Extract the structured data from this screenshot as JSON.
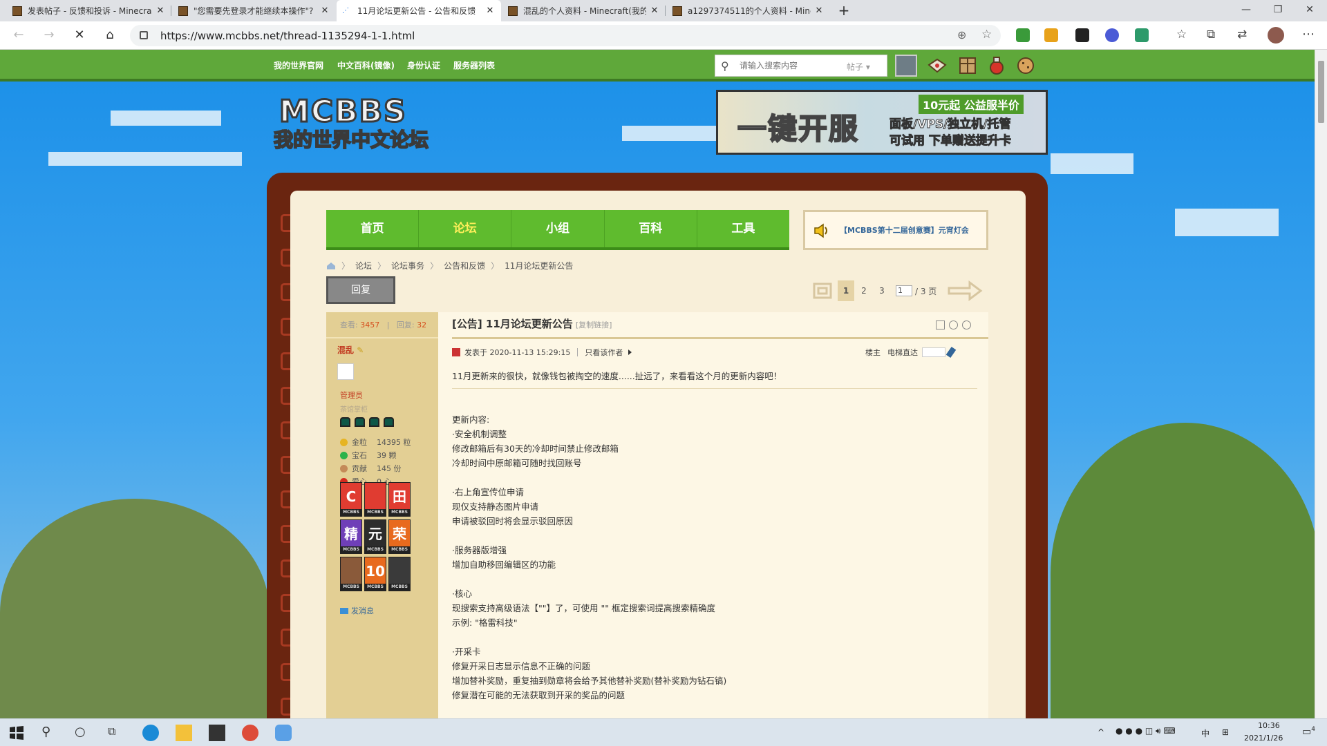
{
  "browser": {
    "tabs": [
      {
        "title": "发表帖子 - 反馈和投诉 - Minecra"
      },
      {
        "title": "\"您需要先登录才能继续本操作\"?"
      },
      {
        "title": "11月论坛更新公告 - 公告和反馈"
      },
      {
        "title": "混乱的个人资料 - Minecraft(我的"
      },
      {
        "title": "a1297374511的个人资料 - Mine"
      }
    ],
    "url": "https://www.mcbbs.net/thread-1135294-1-1.html"
  },
  "topnav": {
    "links": [
      "我的世界官网",
      "中文百科(镜像)",
      "身份认证",
      "服务器列表"
    ],
    "search_placeholder": "请输入搜索内容",
    "search_type": "帖子"
  },
  "banner": {
    "big": "一键开服",
    "tag": "10元起 公益服半价",
    "line1": "面板/VPS/独立机/托管",
    "line2": "可试用 下单赠送提升卡"
  },
  "mainnav": {
    "items": [
      "首页",
      "论坛",
      "小组",
      "百科",
      "工具"
    ],
    "active_index": 1
  },
  "announcement": "【MCBBS第十二届创意赛】元宵灯会",
  "breadcrumbs": [
    "论坛",
    "论坛事务",
    "公告和反馈",
    "11月论坛更新公告"
  ],
  "reply_button": "回复",
  "pager": {
    "pages": [
      "1",
      "2",
      "3"
    ],
    "current": "1",
    "total": "/ 3 页"
  },
  "sidebar": {
    "views_label": "查看:",
    "views": "3457",
    "replies_label": "回复:",
    "replies": "32",
    "username": "混乱",
    "group": "管理员",
    "title": "茶馆掌柜",
    "stats": [
      {
        "label": "金粒",
        "value": "14395 粒",
        "color": "#e6b422"
      },
      {
        "label": "宝石",
        "value": "39 颗",
        "color": "#2db34a"
      },
      {
        "label": "贡献",
        "value": "145 份",
        "color": "#c48a58"
      },
      {
        "label": "爱心",
        "value": "0 心",
        "color": "#d42a1e"
      }
    ],
    "medals": [
      {
        "glyph": "C",
        "color": "#e03c31"
      },
      {
        "glyph": "",
        "color": "#e03c31"
      },
      {
        "glyph": "田",
        "color": "#e03c31"
      },
      {
        "glyph": "精",
        "color": "#6f3fb8"
      },
      {
        "glyph": "元",
        "color": "#2c2c2c"
      },
      {
        "glyph": "荣",
        "color": "#e86a1e"
      },
      {
        "glyph": "",
        "color": "#8a5a3a"
      },
      {
        "glyph": "10",
        "color": "#e86a1e"
      },
      {
        "glyph": "",
        "color": "#3a3a3a"
      }
    ],
    "medal_caption": "MCBBS",
    "send_message": "发消息"
  },
  "post": {
    "title": "[公告] 11月论坛更新公告",
    "copy_link": "[复制链接]",
    "posted": "发表于 2020-11-13 15:29:15",
    "only_author": "只看该作者",
    "floor": "楼主",
    "jump": "电梯直达",
    "lines": [
      "11月更新来的很快，就像钱包被掏空的速度......扯远了，来看看这个月的更新内容吧！",
      "",
      "",
      "更新内容:",
      "·安全机制调整",
      "修改邮箱后有30天的冷却时间禁止修改邮箱",
      "冷却时间中原邮箱可随时找回账号",
      "",
      "·右上角宣传位申请",
      "现仅支持静态图片申请",
      "申请被驳回时将会显示驳回原因",
      "",
      "·服务器版增强",
      "增加自助移回编辑区的功能",
      "",
      "·核心",
      "现搜索支持高级语法【\"\"】了，可使用 \"\" 框定搜索词提高搜索精确度",
      "示例: \"格雷科技\"",
      "",
      "·开采卡",
      "修复开采日志显示信息不正确的问题",
      "增加替补奖励，重复抽到勋章将会给予其他替补奖励(替补奖励为钻石镐)",
      "修复潜在可能的无法获取到开采的奖品的问题"
    ]
  },
  "taskbar": {
    "time": "10:36",
    "date": "2021/1/26",
    "ime": "中",
    "notify_count": "4"
  }
}
